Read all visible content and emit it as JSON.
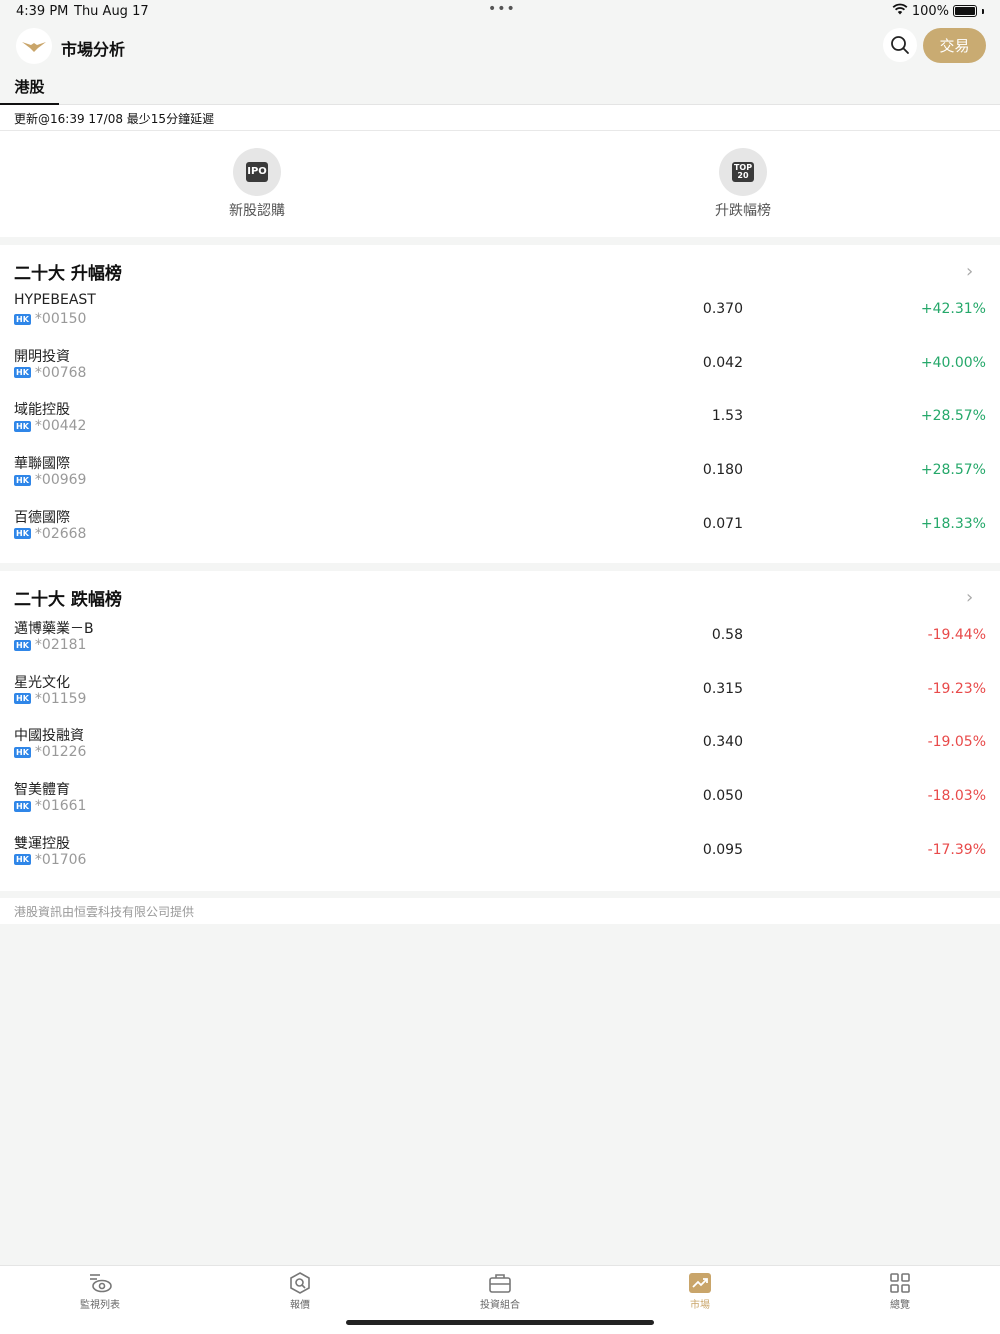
{
  "status_bar": {
    "time": "4:39 PM",
    "date": "Thu Aug 17",
    "dots": "•••",
    "battery": "100%"
  },
  "header": {
    "title": "市場分析",
    "trade_label": "交易"
  },
  "tabs": [
    {
      "label": "港股",
      "active": true
    }
  ],
  "update_text": "更新@16:39 17/08 最少15分鐘延遲",
  "shortcuts": [
    {
      "icon": "ipo-icon",
      "icon_text": "IPO",
      "label": "新股認購"
    },
    {
      "icon": "top20-icon",
      "icon_text": "TOP 20",
      "label": "升跌幅榜"
    }
  ],
  "gainers": {
    "title": "二十大 升幅榜",
    "rows": [
      {
        "name": "HYPEBEAST",
        "market": "HK",
        "code": "*00150",
        "price": "0.370",
        "change": "+42.31%"
      },
      {
        "name": "開明投資",
        "market": "HK",
        "code": "*00768",
        "price": "0.042",
        "change": "+40.00%"
      },
      {
        "name": "域能控股",
        "market": "HK",
        "code": "*00442",
        "price": "1.53",
        "change": "+28.57%"
      },
      {
        "name": "華聯國際",
        "market": "HK",
        "code": "*00969",
        "price": "0.180",
        "change": "+28.57%"
      },
      {
        "name": "百德國際",
        "market": "HK",
        "code": "*02668",
        "price": "0.071",
        "change": "+18.33%"
      }
    ]
  },
  "losers": {
    "title": "二十大 跌幅榜",
    "rows": [
      {
        "name": "邁博藥業－B",
        "market": "HK",
        "code": "*02181",
        "price": "0.58",
        "change": "-19.44%"
      },
      {
        "name": "星光文化",
        "market": "HK",
        "code": "*01159",
        "price": "0.315",
        "change": "-19.23%"
      },
      {
        "name": "中國投融資",
        "market": "HK",
        "code": "*01226",
        "price": "0.340",
        "change": "-19.05%"
      },
      {
        "name": "智美體育",
        "market": "HK",
        "code": "*01661",
        "price": "0.050",
        "change": "-18.03%"
      },
      {
        "name": "雙運控股",
        "market": "HK",
        "code": "*01706",
        "price": "0.095",
        "change": "-17.39%"
      }
    ]
  },
  "footer_note": "港股資訊由恒雲科技有限公司提供",
  "bottom_tabs": [
    {
      "label": "監視列表",
      "icon": "watchlist-icon",
      "active": false
    },
    {
      "label": "報價",
      "icon": "quote-icon",
      "active": false
    },
    {
      "label": "投資組合",
      "icon": "portfolio-icon",
      "active": false
    },
    {
      "label": "市場",
      "icon": "market-icon",
      "active": true
    },
    {
      "label": "總覽",
      "icon": "overview-icon",
      "active": false
    }
  ],
  "colors": {
    "accent": "#c9ab72",
    "up": "#25a86a",
    "down": "#e84a4a",
    "badge": "#2f86e8"
  }
}
